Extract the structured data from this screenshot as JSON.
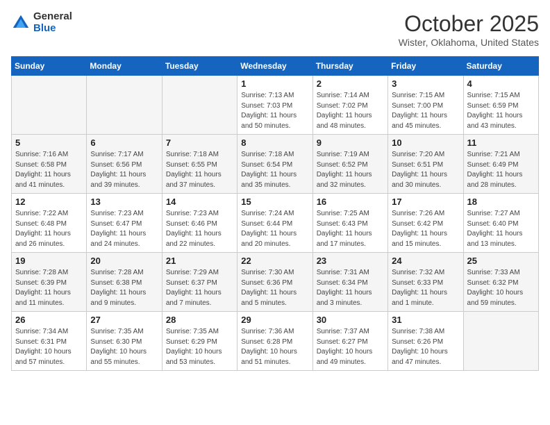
{
  "header": {
    "logo_general": "General",
    "logo_blue": "Blue",
    "month": "October 2025",
    "location": "Wister, Oklahoma, United States"
  },
  "days_of_week": [
    "Sunday",
    "Monday",
    "Tuesday",
    "Wednesday",
    "Thursday",
    "Friday",
    "Saturday"
  ],
  "weeks": [
    [
      {
        "day": "",
        "info": ""
      },
      {
        "day": "",
        "info": ""
      },
      {
        "day": "",
        "info": ""
      },
      {
        "day": "1",
        "info": "Sunrise: 7:13 AM\nSunset: 7:03 PM\nDaylight: 11 hours\nand 50 minutes."
      },
      {
        "day": "2",
        "info": "Sunrise: 7:14 AM\nSunset: 7:02 PM\nDaylight: 11 hours\nand 48 minutes."
      },
      {
        "day": "3",
        "info": "Sunrise: 7:15 AM\nSunset: 7:00 PM\nDaylight: 11 hours\nand 45 minutes."
      },
      {
        "day": "4",
        "info": "Sunrise: 7:15 AM\nSunset: 6:59 PM\nDaylight: 11 hours\nand 43 minutes."
      }
    ],
    [
      {
        "day": "5",
        "info": "Sunrise: 7:16 AM\nSunset: 6:58 PM\nDaylight: 11 hours\nand 41 minutes."
      },
      {
        "day": "6",
        "info": "Sunrise: 7:17 AM\nSunset: 6:56 PM\nDaylight: 11 hours\nand 39 minutes."
      },
      {
        "day": "7",
        "info": "Sunrise: 7:18 AM\nSunset: 6:55 PM\nDaylight: 11 hours\nand 37 minutes."
      },
      {
        "day": "8",
        "info": "Sunrise: 7:18 AM\nSunset: 6:54 PM\nDaylight: 11 hours\nand 35 minutes."
      },
      {
        "day": "9",
        "info": "Sunrise: 7:19 AM\nSunset: 6:52 PM\nDaylight: 11 hours\nand 32 minutes."
      },
      {
        "day": "10",
        "info": "Sunrise: 7:20 AM\nSunset: 6:51 PM\nDaylight: 11 hours\nand 30 minutes."
      },
      {
        "day": "11",
        "info": "Sunrise: 7:21 AM\nSunset: 6:49 PM\nDaylight: 11 hours\nand 28 minutes."
      }
    ],
    [
      {
        "day": "12",
        "info": "Sunrise: 7:22 AM\nSunset: 6:48 PM\nDaylight: 11 hours\nand 26 minutes."
      },
      {
        "day": "13",
        "info": "Sunrise: 7:23 AM\nSunset: 6:47 PM\nDaylight: 11 hours\nand 24 minutes."
      },
      {
        "day": "14",
        "info": "Sunrise: 7:23 AM\nSunset: 6:46 PM\nDaylight: 11 hours\nand 22 minutes."
      },
      {
        "day": "15",
        "info": "Sunrise: 7:24 AM\nSunset: 6:44 PM\nDaylight: 11 hours\nand 20 minutes."
      },
      {
        "day": "16",
        "info": "Sunrise: 7:25 AM\nSunset: 6:43 PM\nDaylight: 11 hours\nand 17 minutes."
      },
      {
        "day": "17",
        "info": "Sunrise: 7:26 AM\nSunset: 6:42 PM\nDaylight: 11 hours\nand 15 minutes."
      },
      {
        "day": "18",
        "info": "Sunrise: 7:27 AM\nSunset: 6:40 PM\nDaylight: 11 hours\nand 13 minutes."
      }
    ],
    [
      {
        "day": "19",
        "info": "Sunrise: 7:28 AM\nSunset: 6:39 PM\nDaylight: 11 hours\nand 11 minutes."
      },
      {
        "day": "20",
        "info": "Sunrise: 7:28 AM\nSunset: 6:38 PM\nDaylight: 11 hours\nand 9 minutes."
      },
      {
        "day": "21",
        "info": "Sunrise: 7:29 AM\nSunset: 6:37 PM\nDaylight: 11 hours\nand 7 minutes."
      },
      {
        "day": "22",
        "info": "Sunrise: 7:30 AM\nSunset: 6:36 PM\nDaylight: 11 hours\nand 5 minutes."
      },
      {
        "day": "23",
        "info": "Sunrise: 7:31 AM\nSunset: 6:34 PM\nDaylight: 11 hours\nand 3 minutes."
      },
      {
        "day": "24",
        "info": "Sunrise: 7:32 AM\nSunset: 6:33 PM\nDaylight: 11 hours\nand 1 minute."
      },
      {
        "day": "25",
        "info": "Sunrise: 7:33 AM\nSunset: 6:32 PM\nDaylight: 10 hours\nand 59 minutes."
      }
    ],
    [
      {
        "day": "26",
        "info": "Sunrise: 7:34 AM\nSunset: 6:31 PM\nDaylight: 10 hours\nand 57 minutes."
      },
      {
        "day": "27",
        "info": "Sunrise: 7:35 AM\nSunset: 6:30 PM\nDaylight: 10 hours\nand 55 minutes."
      },
      {
        "day": "28",
        "info": "Sunrise: 7:35 AM\nSunset: 6:29 PM\nDaylight: 10 hours\nand 53 minutes."
      },
      {
        "day": "29",
        "info": "Sunrise: 7:36 AM\nSunset: 6:28 PM\nDaylight: 10 hours\nand 51 minutes."
      },
      {
        "day": "30",
        "info": "Sunrise: 7:37 AM\nSunset: 6:27 PM\nDaylight: 10 hours\nand 49 minutes."
      },
      {
        "day": "31",
        "info": "Sunrise: 7:38 AM\nSunset: 6:26 PM\nDaylight: 10 hours\nand 47 minutes."
      },
      {
        "day": "",
        "info": ""
      }
    ]
  ]
}
